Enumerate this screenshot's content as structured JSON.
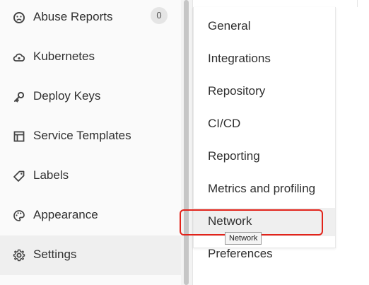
{
  "sidebar": {
    "items": [
      {
        "label": "Abuse Reports",
        "icon": "frown-face-icon",
        "badge": "0"
      },
      {
        "label": "Kubernetes",
        "icon": "kubernetes-cloud-icon"
      },
      {
        "label": "Deploy Keys",
        "icon": "key-icon"
      },
      {
        "label": "Service Templates",
        "icon": "template-icon"
      },
      {
        "label": "Labels",
        "icon": "label-tag-icon"
      },
      {
        "label": "Appearance",
        "icon": "palette-icon"
      },
      {
        "label": "Settings",
        "icon": "gear-icon",
        "active": true
      }
    ]
  },
  "flyout": {
    "items": [
      {
        "label": "General"
      },
      {
        "label": "Integrations"
      },
      {
        "label": "Repository"
      },
      {
        "label": "CI/CD"
      },
      {
        "label": "Reporting"
      },
      {
        "label": "Metrics and profiling"
      },
      {
        "label": "Network",
        "hovered": true
      },
      {
        "label": "Preferences"
      }
    ]
  },
  "tooltip": {
    "text": "Network"
  },
  "colors": {
    "highlight": "#e2231a",
    "sidebar_bg": "#fafafa",
    "active_bg": "#efefef",
    "text": "#303030"
  }
}
